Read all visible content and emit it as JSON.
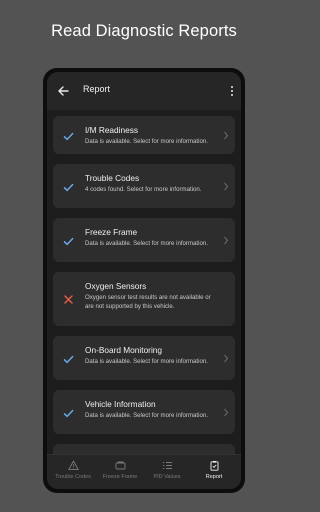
{
  "headline": "Read Diagnostic Reports",
  "appbar": {
    "title": "Report",
    "back_icon": "arrow-left-icon",
    "menu_icon": "more-vertical-icon"
  },
  "colors": {
    "check": "#6aa9e9",
    "error": "#e25a4a",
    "background": "#535353"
  },
  "report_items": [
    {
      "title": "I/M Readiness",
      "description": "Data is available. Select for more information.",
      "status": "available"
    },
    {
      "title": "Trouble Codes",
      "description": "4 codes found. Select for more information.",
      "status": "available"
    },
    {
      "title": "Freeze Frame",
      "description": "Data is available. Select for more information.",
      "status": "available"
    },
    {
      "title": "Oxygen Sensors",
      "description": "Oxygen sensor test results are not available or are not supported by this vehicle.",
      "status": "unavailable"
    },
    {
      "title": "On-Board Monitoring",
      "description": "Data is available. Select for more information.",
      "status": "available"
    },
    {
      "title": "Vehicle Information",
      "description": "Data is available. Select for more information.",
      "status": "available"
    }
  ],
  "bottom_nav": [
    {
      "label": "Trouble Codes",
      "icon": "warning-icon",
      "active": false
    },
    {
      "label": "Freeze Frame",
      "icon": "car-icon",
      "active": false
    },
    {
      "label": "PID Values",
      "icon": "list-icon",
      "active": false
    },
    {
      "label": "Report",
      "icon": "clipboard-icon",
      "active": true
    }
  ]
}
